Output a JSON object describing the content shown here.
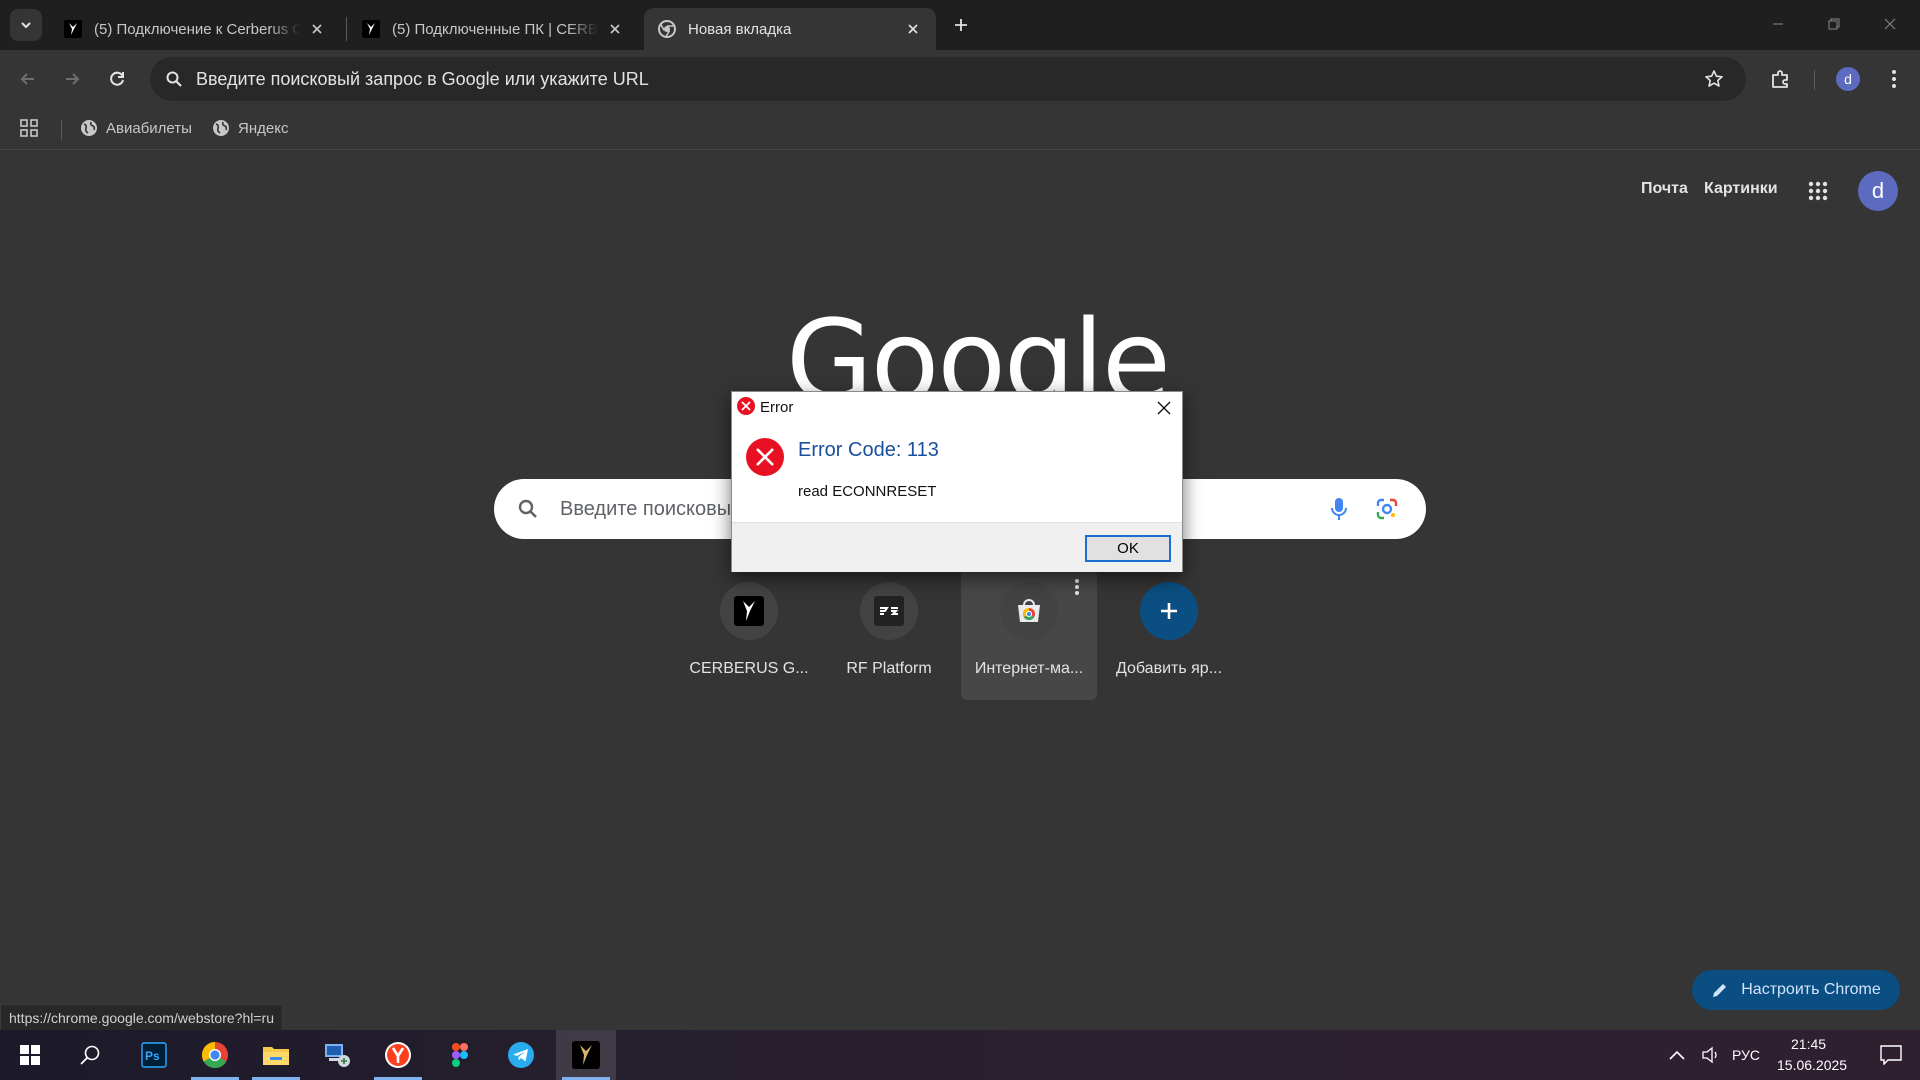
{
  "browser": {
    "tabs": [
      {
        "title": "(5) Подключение к Cerberus GPU",
        "active": false
      },
      {
        "title": "(5) Подключенные ПК | CERBERUS",
        "active": false
      },
      {
        "title": "Новая вкладка",
        "active": true
      }
    ],
    "omnibox_placeholder": "Введите поисковый запрос в Google или укажите URL",
    "bookmarks": [
      {
        "label": "Авиабилеты"
      },
      {
        "label": "Яндекс"
      }
    ],
    "profile_initial": "d",
    "status_url": "https://chrome.google.com/webstore?hl=ru"
  },
  "ntp": {
    "links": {
      "mail": "Почта",
      "images": "Картинки"
    },
    "profile_initial": "d",
    "logo_text": "Google",
    "search_placeholder": "Введите поисковый запрос в Google или укажите URL",
    "shortcuts": [
      {
        "label": "CERBERUS G..."
      },
      {
        "label": "RF Platform"
      },
      {
        "label": "Интернет-ма..."
      },
      {
        "label": "Добавить яр..."
      }
    ],
    "customize_label": "Настроить Chrome"
  },
  "dialog": {
    "title": "Error",
    "heading": "Error Code: 113",
    "message": "read ECONNRESET",
    "ok_label": "OK"
  },
  "taskbar": {
    "language": "РУС",
    "time": "21:45",
    "date": "15.06.2025",
    "apps": [
      "start-icon",
      "search-icon",
      "photoshop-icon",
      "chrome-icon",
      "file-explorer-icon",
      "network-computer-icon",
      "yandex-browser-icon",
      "figma-icon",
      "telegram-icon",
      "cerberus-icon"
    ]
  },
  "colors": {
    "tabstrip_bg": "#1f1f1f",
    "page_bg": "#353535",
    "accent_blue": "#0b4f82",
    "dialog_heading": "#1a4fa0",
    "error_red": "#e81123"
  }
}
